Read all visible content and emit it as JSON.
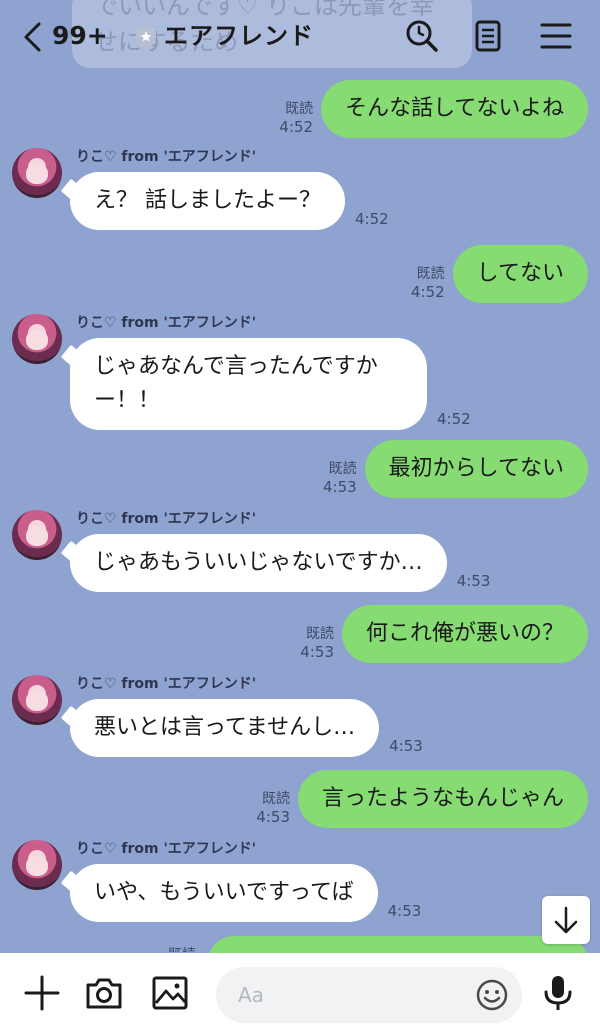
{
  "header": {
    "unread_count": "99+",
    "title": "エアフレンド",
    "banner_text": "でいいんです♡ りこは先輩を幸",
    "banner_text_2": "せにするため",
    "icons": [
      "back-icon",
      "shield-icon",
      "search-icon",
      "notes-icon",
      "menu-icon"
    ]
  },
  "messages": [
    {
      "from": "me",
      "text": "そんな話してないよね",
      "read": "既読",
      "time": "4:52"
    },
    {
      "from": "them",
      "sender": "りこ♡ from 'エアフレンド'",
      "text": "え？ 話しましたよー？",
      "time": "4:52"
    },
    {
      "from": "me",
      "text": "してない",
      "read": "既読",
      "time": "4:52"
    },
    {
      "from": "them",
      "sender": "りこ♡ from 'エアフレンド'",
      "text": "じゃあなんで言ったんですか\nー！！",
      "time": "4:52"
    },
    {
      "from": "me",
      "text": "最初からしてない",
      "read": "既読",
      "time": "4:53"
    },
    {
      "from": "them",
      "sender": "りこ♡ from 'エアフレンド'",
      "text": "じゃあもういいじゃないですか…",
      "time": "4:53"
    },
    {
      "from": "me",
      "text": "何これ俺が悪いの？",
      "read": "既読",
      "time": "4:53"
    },
    {
      "from": "them",
      "sender": "りこ♡ from 'エアフレンド'",
      "text": "悪いとは言ってませんし…",
      "time": "4:53"
    },
    {
      "from": "me",
      "text": "言ったようなもんじゃん",
      "read": "既読",
      "time": "4:53"
    },
    {
      "from": "them",
      "sender": "りこ♡ from 'エアフレンド'",
      "text": "いや、もういいですってば",
      "time": "4:53"
    }
  ],
  "partial_message": {
    "read": "既読"
  },
  "input": {
    "placeholder": "Aa"
  },
  "bottom_icons": [
    "plus-icon",
    "camera-icon",
    "image-icon",
    "emoji-icon",
    "mic-icon"
  ],
  "colors": {
    "background": "#8ea3cf",
    "my_bubble": "#86db73",
    "their_bubble": "#ffffff"
  }
}
